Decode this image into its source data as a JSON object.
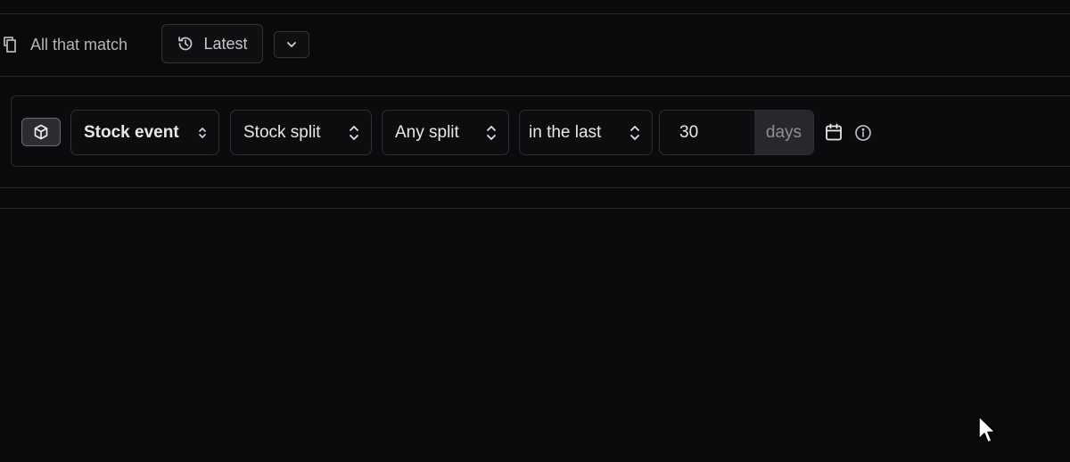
{
  "toolbar": {
    "match_label": "All that match",
    "latest_label": "Latest"
  },
  "filter": {
    "event_type": "Stock event",
    "event_subtype": "Stock split",
    "split_type": "Any split",
    "time_operator": "in the last",
    "amount": "30",
    "unit": "days"
  },
  "icons": {
    "match": "copy-icon",
    "latest": "history-icon",
    "dropdown": "chevron-down-icon",
    "entity": "cube-icon",
    "sort": "chevron-up-down-icon",
    "calendar": "calendar-icon",
    "info": "info-icon",
    "cursor": "mouse-pointer-icon"
  },
  "colors": {
    "background": "#0a0a0b",
    "border": "#2e2e33",
    "unit_bg": "#28282c",
    "text": "#e8e8ea",
    "muted_text": "#8e8e94"
  }
}
